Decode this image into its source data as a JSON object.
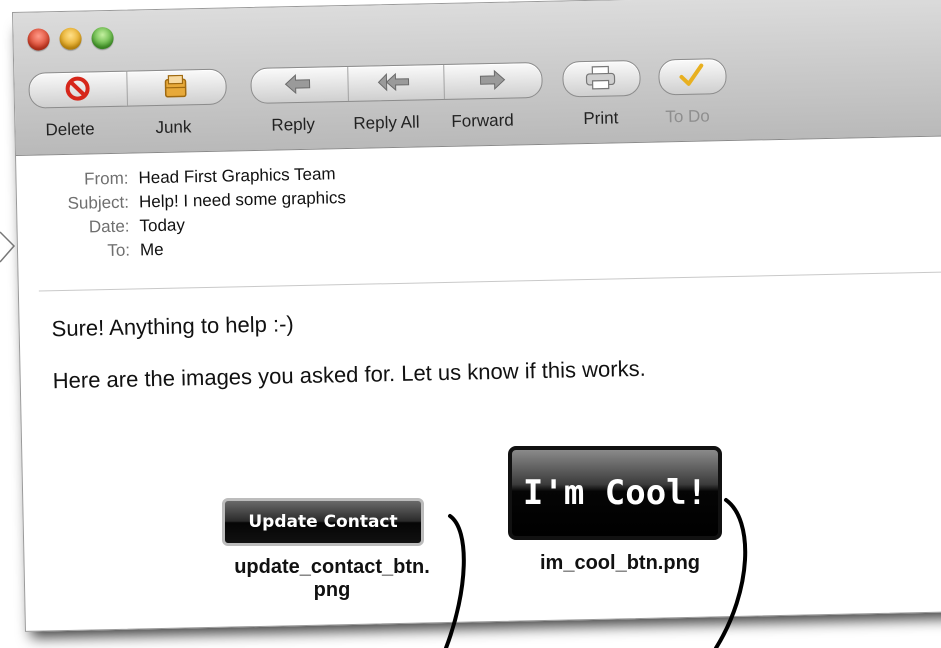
{
  "toolbar": {
    "buttons": [
      {
        "label": "Delete",
        "icon": "delete-icon"
      },
      {
        "label": "Junk",
        "icon": "junk-icon"
      },
      {
        "label": "Reply",
        "icon": "reply-icon"
      },
      {
        "label": "Reply All",
        "icon": "reply-all-icon"
      },
      {
        "label": "Forward",
        "icon": "forward-icon"
      },
      {
        "label": "Print",
        "icon": "print-icon"
      },
      {
        "label": "To Do",
        "icon": "todo-icon"
      }
    ]
  },
  "message": {
    "headers": [
      {
        "key": "From:",
        "value": "Head First Graphics Team"
      },
      {
        "key": "Subject:",
        "value": "Help! I need some graphics"
      },
      {
        "key": "Date:",
        "value": "Today"
      },
      {
        "key": "To:",
        "value": "Me"
      }
    ],
    "body": [
      "Sure! Anything to help :-)",
      "Here are the images you asked for. Let us know if this works."
    ],
    "attachments": [
      {
        "button_text": "Update Contact",
        "filename_line1": "update_contact_btn.",
        "filename_line2": "png"
      },
      {
        "button_text": "I'm Cool!",
        "filename_line1": "im_cool_btn.png"
      }
    ]
  },
  "colors": {
    "close": "#d43a22",
    "minimize": "#e0a012",
    "zoom": "#4aa62e",
    "todo_check": "#e8b020",
    "delete_icon": "#d6261a"
  }
}
